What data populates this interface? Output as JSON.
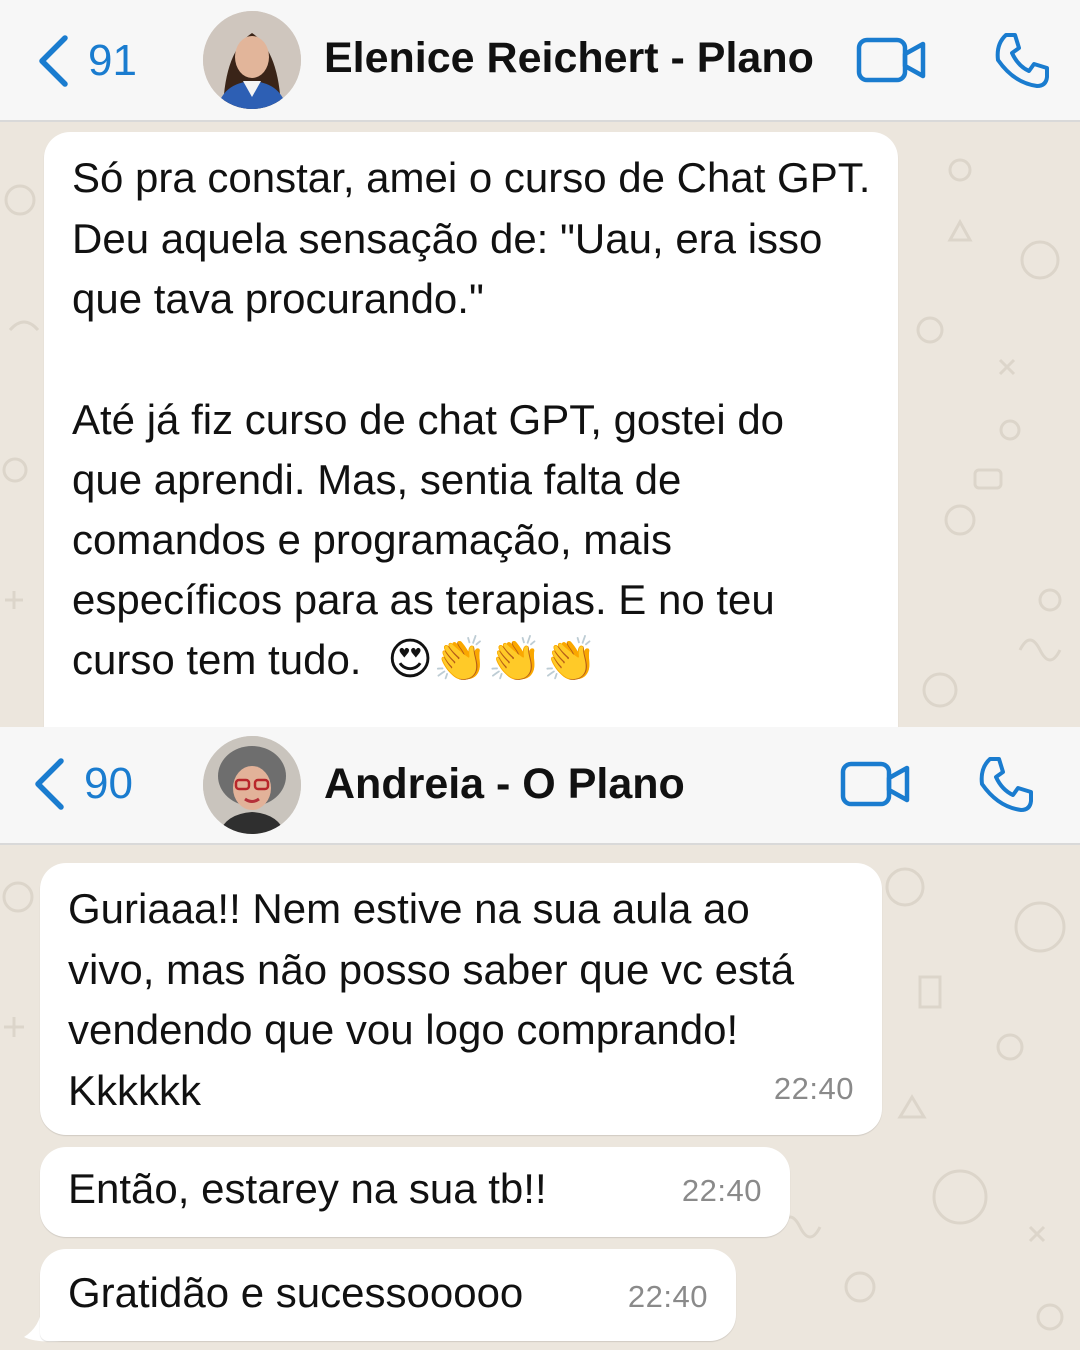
{
  "chat1": {
    "back_count": "91",
    "contact_name": "Elenice Reichert - Plano",
    "message": {
      "paragraph1": "Só pra constar, amei o curso de Chat GPT. Deu aquela sensação de: \"Uau, era isso que tava procurando.\"",
      "paragraph2_line1": "Até já fiz curso de chat GPT, gostei do",
      "paragraph2_line2": "que aprendi. Mas, sentia falta de",
      "paragraph2_line3": "comandos e programação, mais",
      "paragraph2_line4": "específicos para as terapias. E no teu",
      "paragraph2_line5": "curso tem tudo.",
      "emojis": "😍👏👏👏"
    }
  },
  "chat2": {
    "back_count": "90",
    "contact_name": "Andreia - O Plano",
    "messages": [
      {
        "text": "Guriaaa!! Nem estive na sua aula ao vivo, mas não posso saber que vc está vendendo que vou logo comprando! Kkkkkk",
        "time": "22:40"
      },
      {
        "text": "Então, estarey na sua tb!!",
        "time": "22:40"
      },
      {
        "text": "Gratidão e sucessooooo",
        "time": "22:40"
      }
    ]
  },
  "colors": {
    "accent": "#1a7ccf",
    "chat_background": "#ece6dd",
    "bubble": "#ffffff",
    "header": "#f7f7f7"
  },
  "icons": [
    "chevron-left-icon",
    "video-camera-icon",
    "phone-icon"
  ]
}
